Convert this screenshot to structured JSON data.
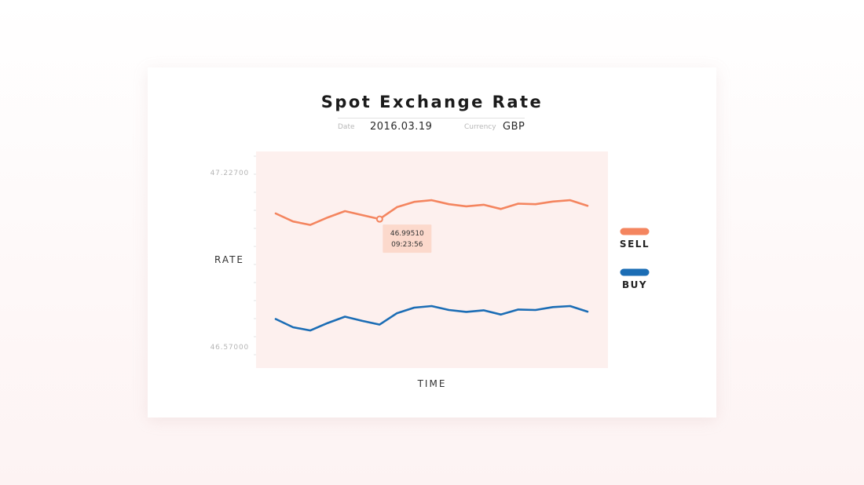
{
  "title": "Spot Exchange Rate",
  "meta": {
    "date_label": "Date",
    "date_value": "2016.03.19",
    "currency_label": "Currency",
    "currency_value": "GBP"
  },
  "chart_data": {
    "type": "line",
    "ylabel": "RATE",
    "xlabel": "TIME",
    "y_ticks": [
      "47.22700",
      "46.57000"
    ],
    "ylim": [
      46.57,
      47.227
    ],
    "grid": false,
    "legend_placement": "right",
    "series": [
      {
        "name": "SELL",
        "color": "#f4855f",
        "values": [
          47.073,
          47.043,
          47.03,
          47.058,
          47.082,
          47.067,
          47.052,
          47.097,
          47.117,
          47.123,
          47.108,
          47.1,
          47.106,
          47.09,
          47.11,
          47.108,
          47.118,
          47.123,
          47.102
        ]
      },
      {
        "name": "BUY",
        "color": "#1b6db5",
        "values": [
          46.675,
          46.644,
          46.632,
          46.66,
          46.684,
          46.668,
          46.654,
          46.697,
          46.718,
          46.724,
          46.709,
          46.702,
          46.708,
          46.692,
          46.711,
          46.709,
          46.72,
          46.724,
          46.703
        ]
      }
    ],
    "tooltip": {
      "series": "SELL",
      "index": 6,
      "value": "46.99510",
      "time": "09:23:56"
    }
  }
}
